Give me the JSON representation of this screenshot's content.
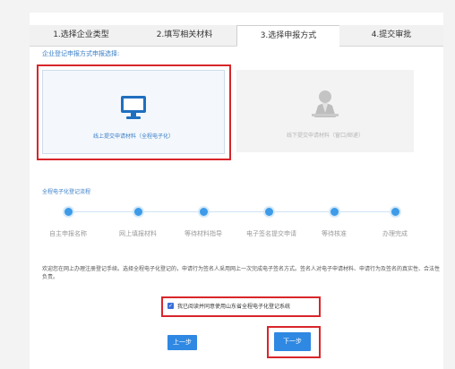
{
  "tabs": [
    {
      "label": "1.选择企业类型",
      "active": false
    },
    {
      "label": "2.填写相关材料",
      "active": false
    },
    {
      "label": "3.选择申报方式",
      "active": true
    },
    {
      "label": "4.提交审批",
      "active": false
    }
  ],
  "section_title": "企业登记申报方式申报选择:",
  "options": {
    "online": {
      "label": "线上提交申请材料（全程电子化）",
      "icon": "monitor-icon",
      "selected": true
    },
    "offline": {
      "label": "线下提交申请材料（窗口/邮递）",
      "icon": "clerk-icon",
      "selected": false
    }
  },
  "flow": {
    "title": "全程电子化登记流程",
    "steps": [
      "自主申报名称",
      "网上填报材料",
      "等待材料指导",
      "电子签名提交申请",
      "等待核准",
      "办理完成"
    ]
  },
  "notice": "欢迎您在网上办理注册登记手续。选择全程电子化登记的，申请行为签名人采用网上一次完成电子签名方式。签名人对电子申请材料、申请行为及签名的真实性、合法性负责。",
  "agreement": {
    "label": "我已阅读并同意使用山东省全程电子化登记系统",
    "checked": true
  },
  "buttons": {
    "prev": "上一步",
    "next": "下一步"
  },
  "colors": {
    "accent": "#2f88e2",
    "highlight": "#d8262b",
    "link_text": "#3a7ec6",
    "dot": "#3d9be9"
  }
}
